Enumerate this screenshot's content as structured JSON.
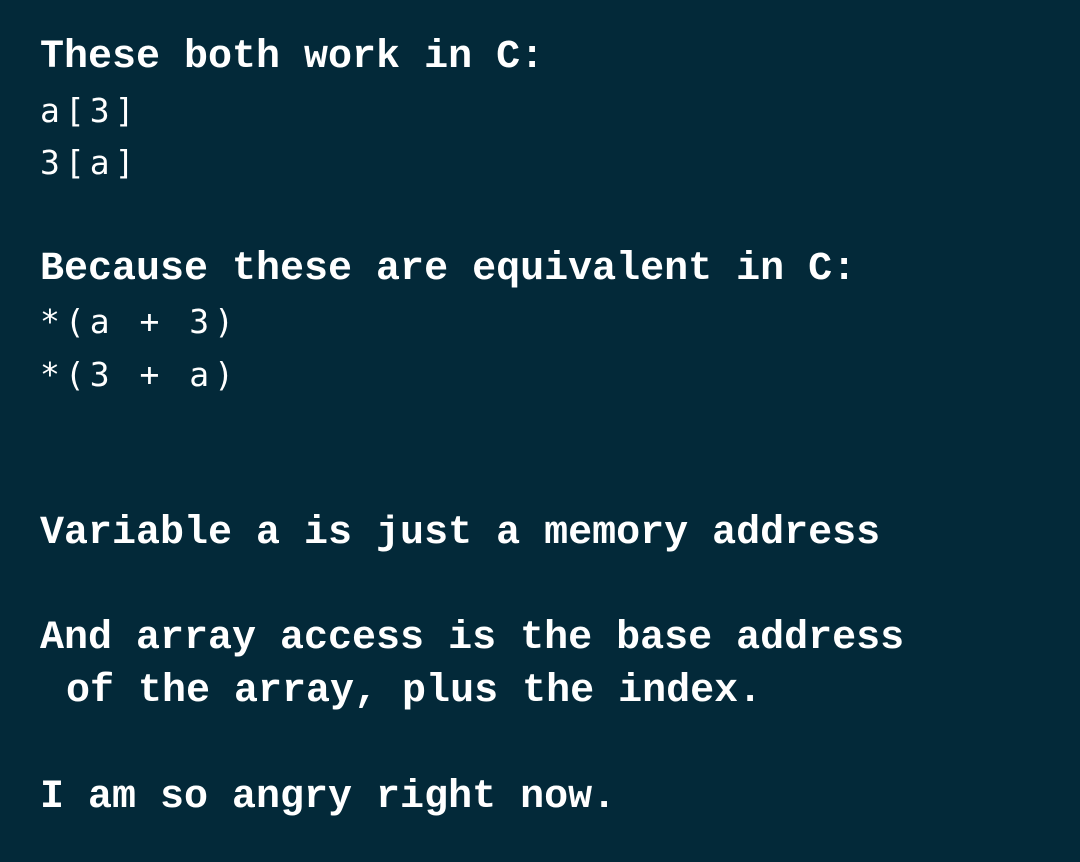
{
  "block1": {
    "heading": "These both work in C:",
    "code": [
      "a[3]",
      "3[a]"
    ]
  },
  "block2": {
    "heading": "Because these are equivalent in C:",
    "code": [
      "*(a + 3)",
      "*(3 + a)"
    ]
  },
  "block3": {
    "text": "Variable a is just a memory address"
  },
  "block4": {
    "lines": [
      "And array access is the base address",
      "of the array, plus the index."
    ]
  },
  "block5": {
    "text": "I am so angry right now."
  }
}
